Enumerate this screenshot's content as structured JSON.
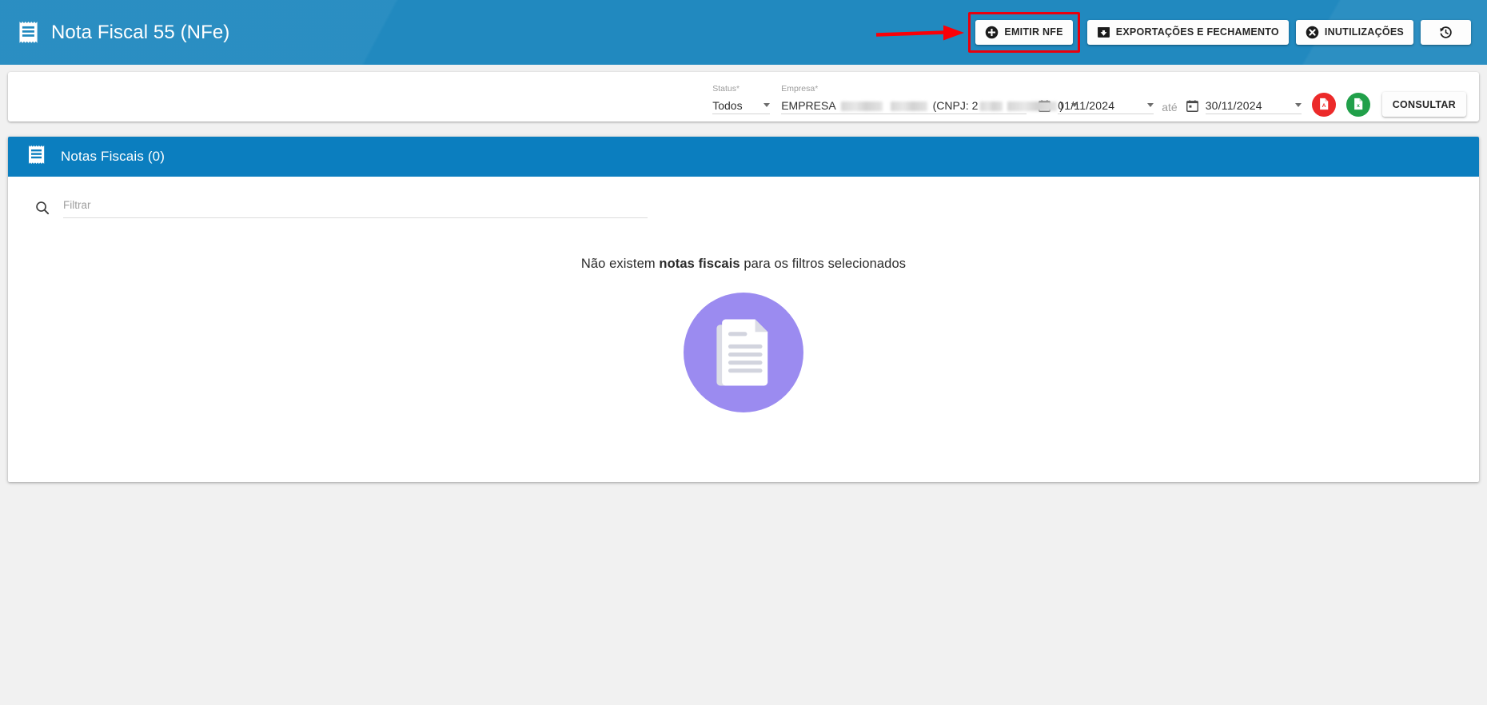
{
  "header": {
    "title": "Nota Fiscal 55 (NFe)",
    "icon": "receipt-icon",
    "actions": [
      {
        "label": "EMITIR NFE",
        "icon": "plus-circle-icon",
        "highlighted": true
      },
      {
        "label": "EXPORTAÇÕES E FECHAMENTO",
        "icon": "download-box-icon",
        "highlighted": false
      },
      {
        "label": "INUTILIZAÇÕES",
        "icon": "x-circle-icon",
        "highlighted": false
      },
      {
        "label": "",
        "icon": "history-clock-icon",
        "highlighted": false
      }
    ],
    "annotation": {
      "type": "arrow",
      "color": "#e8000d",
      "points_to": "EMITIR NFE"
    },
    "colors": {
      "background": "#2189bf",
      "title": "#ffffff",
      "highlight": "#e8000d"
    }
  },
  "filters": {
    "status": {
      "label": "Status",
      "required_mark": "*",
      "value": "Todos",
      "options": [
        "Todos"
      ]
    },
    "empresa": {
      "label": "Empresa",
      "required_mark": "*",
      "value_prefix": "EMPRESA",
      "value_redacted": true,
      "cnpj_prefix": "(CNPJ: 2",
      "cnpj_suffix": ")"
    },
    "date_start": {
      "value": "01/11/2024",
      "icon": "calendar-icon"
    },
    "separator_label": "até",
    "date_end": {
      "value": "30/11/2024",
      "icon": "calendar-icon"
    },
    "export_pdf": {
      "icon": "pdf-icon",
      "color": "#ec2a2a"
    },
    "export_xls": {
      "icon": "excel-icon",
      "color": "#21a04a"
    },
    "submit": {
      "label": "CONSULTAR"
    }
  },
  "list": {
    "header": {
      "title": "Notas Fiscais (0)",
      "count": 0,
      "icon": "receipt-icon",
      "background": "#0b7ebf"
    },
    "search": {
      "placeholder": "Filtrar",
      "value": "",
      "icon": "search-icon"
    },
    "empty_state": {
      "text_before": "Não existem ",
      "text_strong": "notas fiscais",
      "text_after": " para os filtros selecionados",
      "illustration": "documents-illustration",
      "illustration_color": "#9b8bf0"
    }
  },
  "page": {
    "background": "#f1f1f1"
  }
}
